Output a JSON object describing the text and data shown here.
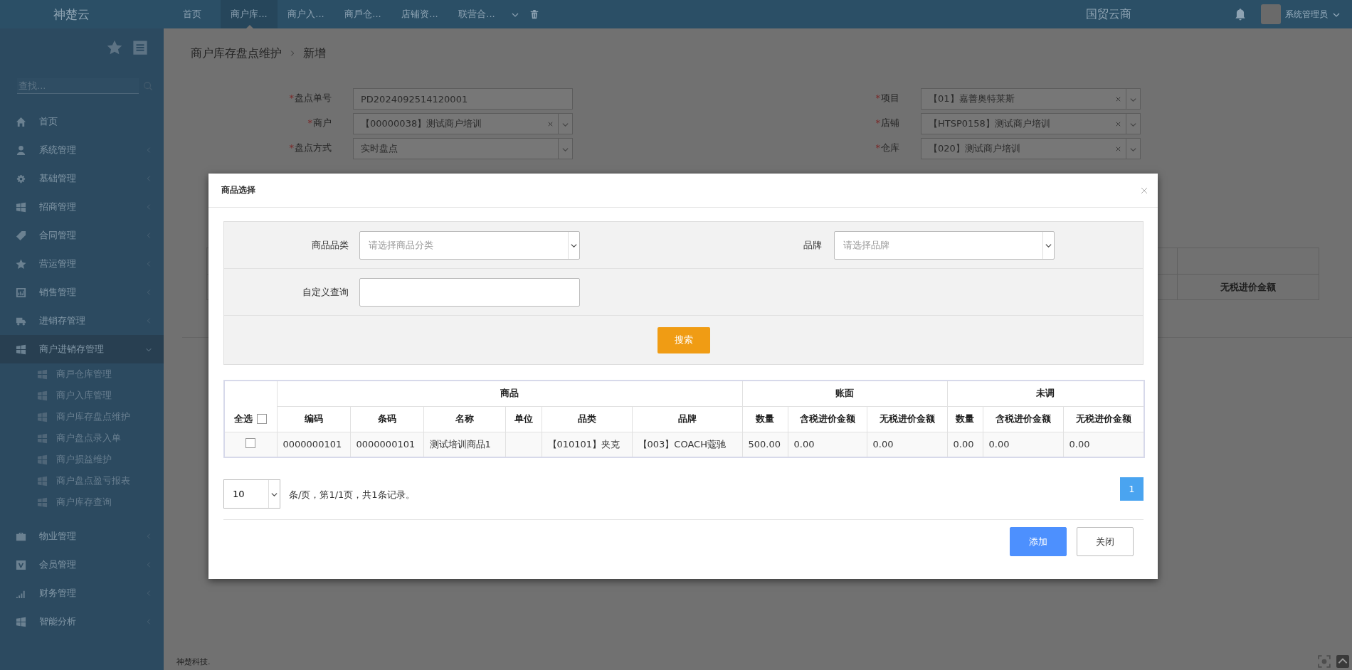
{
  "top_bar": {
    "logo": "神楚云",
    "nav_tabs": [
      {
        "label": "首页",
        "selected": false
      },
      {
        "label": "商户库...",
        "selected": true
      },
      {
        "label": "商户入...",
        "selected": false
      },
      {
        "label": "商戶仓...",
        "selected": false
      },
      {
        "label": "店铺资...",
        "selected": false
      },
      {
        "label": "联营合...",
        "selected": false
      }
    ],
    "brand": "国贸云商",
    "user": "系统管理员"
  },
  "sidebar": {
    "search": {
      "placeholder": "查找..."
    },
    "items": [
      {
        "label": "首页"
      },
      {
        "label": "系统管理",
        "expanded": false
      },
      {
        "label": "基础管理",
        "expanded": false
      },
      {
        "label": "招商管理",
        "expanded": false
      },
      {
        "label": "合同管理",
        "expanded": false
      },
      {
        "label": "营运管理",
        "expanded": false
      },
      {
        "label": "销售管理",
        "expanded": false
      },
      {
        "label": "进销存管理",
        "expanded": false
      },
      {
        "label": "商户进销存管理",
        "expanded": true,
        "children": [
          {
            "label": "商戸仓库管理"
          },
          {
            "label": "商户入库管理"
          },
          {
            "label": "商户库存盘点维护"
          },
          {
            "label": "商户盘点录入单"
          },
          {
            "label": "商户损益维护"
          },
          {
            "label": "商户盘点盈亏报表"
          },
          {
            "label": "商户库存查询"
          }
        ]
      },
      {
        "label": "物业管理",
        "expanded": false
      },
      {
        "label": "会员管理",
        "expanded": false
      },
      {
        "label": "财务管理",
        "expanded": false
      },
      {
        "label": "智能分析",
        "expanded": false
      }
    ]
  },
  "breadcrumb": [
    "商户库存盘点维护",
    "新增"
  ],
  "form": {
    "rows": [
      [
        {
          "mark": "*",
          "label": "盘点单号",
          "kind": "text",
          "value": "PD2024092514120001"
        },
        {
          "mark": "*",
          "label": "项目",
          "kind": "select",
          "clearable": true,
          "value": "【01】嘉善奥特莱斯"
        }
      ],
      [
        {
          "mark": "*",
          "label": "商户",
          "kind": "select",
          "clearable": true,
          "value": "【00000038】测试商户培训"
        },
        {
          "mark": "*",
          "label": "店铺",
          "kind": "select",
          "clearable": true,
          "value": "【HTSP0158】测试商户培训"
        }
      ],
      [
        {
          "mark": "*",
          "label": "盘点方式",
          "kind": "select",
          "clearable": false,
          "value": "实时盘点"
        },
        {
          "mark": "*",
          "label": "仓库",
          "kind": "select",
          "clearable": true,
          "value": "【020】测试商户培训"
        }
      ]
    ]
  },
  "background_table": {
    "columns": [
      "无税进价金额"
    ]
  },
  "modal": {
    "title": "商品选择",
    "filters": [
      {
        "label": "商品品类",
        "kind": "select",
        "placeholder": "请选择商品分类"
      },
      {
        "label": "品牌",
        "kind": "select",
        "placeholder": "请选择品牌"
      },
      {
        "label": "自定义查询",
        "kind": "text"
      }
    ],
    "search_button": "搜索",
    "table": {
      "select_all": {
        "label": "全选",
        "checked": false
      },
      "column_groups": [
        {
          "label": "商品",
          "columns": [
            "编码",
            "条码",
            "名称",
            "单位",
            "品类",
            "品牌"
          ]
        },
        {
          "label": "账面",
          "columns": [
            "数量",
            "含税进价金额",
            "无税进价金额"
          ]
        },
        {
          "label": "未调",
          "columns": [
            "数量",
            "含税进价金额",
            "无税进价金额"
          ]
        }
      ],
      "rows": [
        {
          "checked": false,
          "cells": [
            "0000000101",
            "0000000101",
            "测试培训商品1",
            "",
            "【010101】夹克",
            "【003】COACH蔻驰",
            "500.00",
            "0.00",
            "0.00",
            "0.00",
            "0.00",
            "0.00"
          ]
        }
      ]
    },
    "pagination": {
      "page_size": "10",
      "summary": "条/页，第1/1页，共1条记录。",
      "pages": [
        {
          "label": "1",
          "selected": true
        }
      ]
    },
    "buttons": [
      {
        "label": "添加",
        "kind": "primary"
      },
      {
        "label": "关闭",
        "kind": "default"
      }
    ]
  },
  "footer": "神楚科技."
}
